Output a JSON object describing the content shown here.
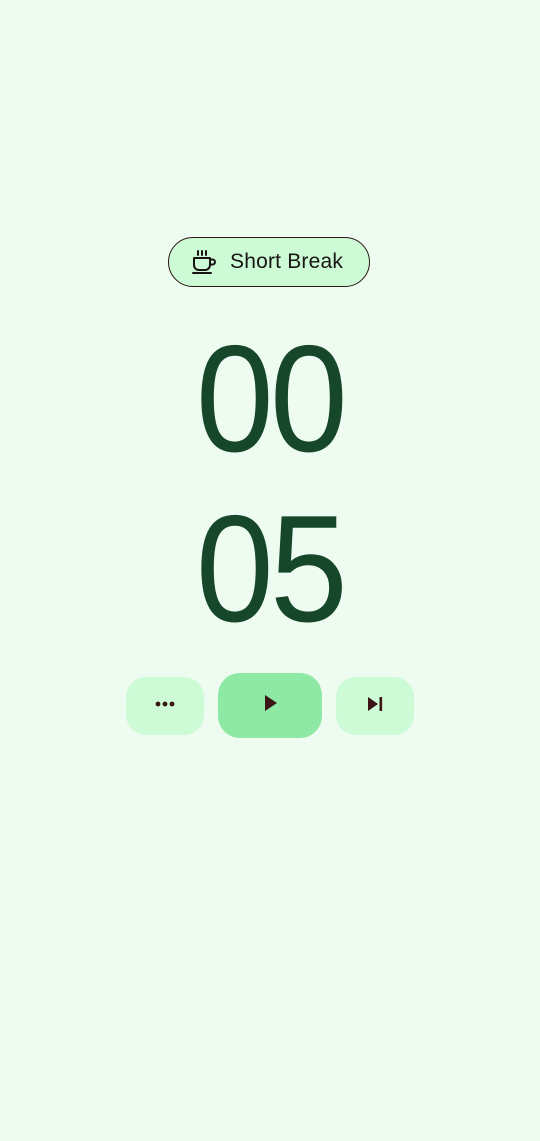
{
  "session": {
    "label": "Short Break",
    "icon": "coffee-cup-icon"
  },
  "timer": {
    "minutes": "00",
    "seconds": "05"
  },
  "controls": {
    "more_icon": "more-horizontal-icon",
    "play_icon": "play-icon",
    "skip_icon": "skip-next-icon"
  },
  "colors": {
    "background": "#eefbf1",
    "chip_background": "#ccfbd6",
    "chip_border": "#2d1414",
    "digit_color": "#17472a",
    "primary_button": "#8de9a3",
    "secondary_button": "#ccfbd6",
    "icon_color": "#3b1515"
  }
}
